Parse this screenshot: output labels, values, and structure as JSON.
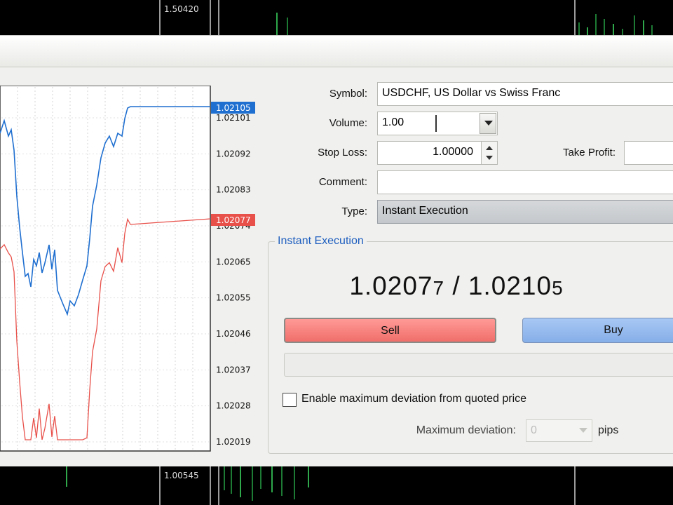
{
  "background": {
    "top_price_label": "1.50420",
    "bottom_price_label": "1.00545"
  },
  "chart": {
    "price_labels": [
      "1.02101",
      "1.02092",
      "1.02083",
      "1.02074",
      "1.02065",
      "1.02055",
      "1.02046",
      "1.02037",
      "1.02028",
      "1.02019"
    ],
    "ask_label": "1.02105",
    "bid_label": "1.02077",
    "ask_color": "#1f6fd0",
    "bid_color": "#e8504a"
  },
  "form": {
    "symbol_label": "Symbol:",
    "symbol_value": "USDCHF, US Dollar vs Swiss Franc",
    "volume_label": "Volume:",
    "volume_value": "1.00",
    "stoploss_label": "Stop Loss:",
    "stoploss_value": "1.00000",
    "takeprofit_label": "Take Profit:",
    "comment_label": "Comment:",
    "comment_value": "",
    "type_label": "Type:",
    "type_value": "Instant Execution"
  },
  "execution": {
    "group_title": "Instant Execution",
    "bid_main": "1.0207",
    "bid_last": "7",
    "separator": "/",
    "ask_main": "1.0210",
    "ask_last": "5",
    "sell_label": "Sell",
    "buy_label": "Buy",
    "deviation_checkbox_label": "Enable maximum deviation from quoted price",
    "max_deviation_label": "Maximum deviation:",
    "max_deviation_value": "0",
    "pips_label": "pips"
  }
}
